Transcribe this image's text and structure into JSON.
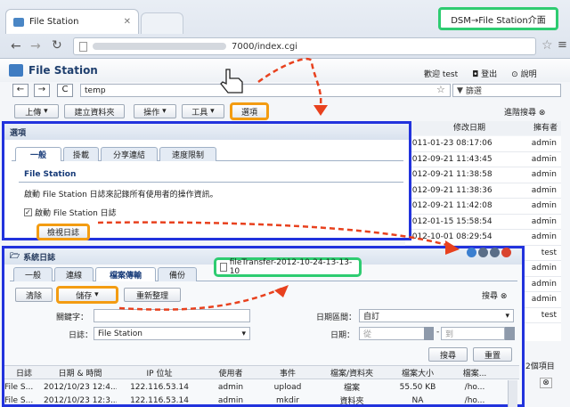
{
  "browser": {
    "tab_title": "File Station",
    "url": "7000/index.cgi"
  },
  "callout_text": "DSM→File Station介面",
  "app": {
    "title": "File Station",
    "welcome": "歡迎 test",
    "logout": "登出",
    "help": "說明",
    "path": "temp",
    "filter_placeholder": "篩選"
  },
  "toolbar": {
    "upload": "上傳",
    "create": "建立資料夾",
    "action": "操作",
    "tools": "工具",
    "options": "選項",
    "advanced": "進階搜尋"
  },
  "columns": {
    "modified": "修改日期",
    "owner": "擁有者"
  },
  "file_rows": [
    {
      "date": "2011-01-23 08:17:06",
      "owner": "admin"
    },
    {
      "date": "2012-09-21 11:43:45",
      "owner": "admin"
    },
    {
      "date": "2012-09-21 11:38:58",
      "owner": "admin"
    },
    {
      "date": "2012-09-21 11:38:36",
      "owner": "admin"
    },
    {
      "date": "2012-09-21 11:42:08",
      "owner": "admin"
    },
    {
      "date": "2012-01-15 15:58:54",
      "owner": "admin"
    },
    {
      "date": "2012-10-01 08:29:54",
      "owner": "admin"
    },
    {
      "date": "",
      "owner": "test"
    },
    {
      "date": "",
      "owner": "admin"
    },
    {
      "date": "",
      "owner": "admin"
    },
    {
      "date": "",
      "owner": "admin"
    },
    {
      "date": "",
      "owner": "test"
    }
  ],
  "options_panel": {
    "title": "選項",
    "tabs": [
      "一般",
      "掛載",
      "分享連結",
      "速度限制"
    ],
    "section": "File Station",
    "desc": "啟動 File Station 日誌來記錄所有使用者的操作資訊。",
    "checkbox": "啟動 File Station 日誌",
    "view_log": "檢視日誌"
  },
  "log_panel": {
    "title": "系統日誌",
    "tabs": [
      "一般",
      "連線",
      "檔案傳輸",
      "備份"
    ],
    "clear": "清除",
    "save": "儲存",
    "refresh": "重新整理",
    "search": "搜尋",
    "keyword": "關鍵字：",
    "log": "日誌：",
    "log_value": "File Station",
    "date_range": "日期區間：",
    "date_range_value": "自訂",
    "date": "日期：",
    "from": "從",
    "to": "到",
    "search_btn": "搜尋",
    "reset": "重置",
    "side_label": "2個項目"
  },
  "saved_file": "fileTransfer-2012-10-24-13-13-10",
  "log_table": {
    "headers": [
      "日誌",
      "日期 & 時間",
      "IP 位址",
      "使用者",
      "事件",
      "檔案/資料夾",
      "檔案大小",
      "檔案..."
    ],
    "rows": [
      [
        "File S...",
        "2012/10/23 12:4...",
        "122.116.53.14",
        "admin",
        "upload",
        "檔案",
        "55.50 KB",
        "/ho..."
      ],
      [
        "File S...",
        "2012/10/23 12:3...",
        "122.116.53.14",
        "admin",
        "mkdir",
        "資料夾",
        "NA",
        "/ho..."
      ]
    ]
  }
}
